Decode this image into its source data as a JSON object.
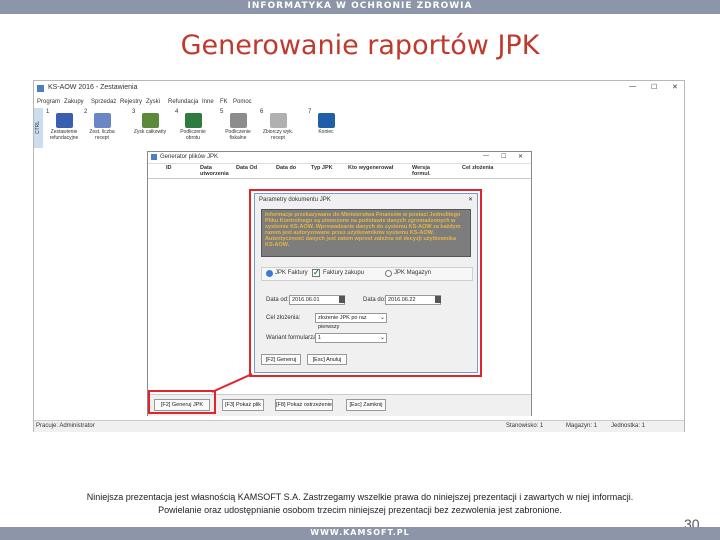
{
  "slide": {
    "header": "INFORMATYKA W OCHRONIE ZDROWIA",
    "title": "Generowanie raportów JPK",
    "disclaimer_line1": "Niniejsza prezentacja jest własnością KAMSOFT S.A. Zastrzegamy wszelkie prawa do niniejszej prezentacji i zawartych w niej informacji.",
    "disclaimer_line2": "Powielanie oraz udostępnianie osobom trzecim niniejszej prezentacji bez zezwolenia jest zabronione.",
    "page_number": "30",
    "footer": "WWW.KAMSOFT.PL"
  },
  "app": {
    "title": "KS-AOW 2016 - Zestawienia",
    "window_controls": [
      "—",
      "☐",
      "✕"
    ],
    "menu": [
      "Program",
      "Zakupy",
      "Sprzedaż",
      "Rejestry",
      "Zyski",
      "Refundacja",
      "Inne",
      "FK",
      "Pomoc"
    ],
    "sidebar_label": "CTRL",
    "toolbar": [
      {
        "num": "1",
        "label": "Zestawienie refundacyjne",
        "color": "#3a5fb0"
      },
      {
        "num": "2",
        "label": "Zest. liczba recept",
        "color": "#6b86c4"
      },
      {
        "num": "3",
        "label": "Zysk całkowity",
        "color": "#5a8a3a"
      },
      {
        "num": "4",
        "label": "Podliczenie obrotu",
        "color": "#2f7a3e"
      },
      {
        "num": "5",
        "label": "Podliczenie fiskalne",
        "color": "#8c8c8c"
      },
      {
        "num": "6",
        "label": "Zbiorczy wyk. recept",
        "color": "#b0b0b0"
      },
      {
        "num": "7",
        "label": "Koniec",
        "color": "#1f5fa8"
      }
    ],
    "status": {
      "operator": "Pracuje: Administrator",
      "stanowisko": "Stanowisko: 1",
      "magazyn": "Magazyn: 1",
      "jednostka": "Jednostka: 1"
    }
  },
  "generator": {
    "title": "Generator plików JPK",
    "columns": [
      "ID",
      "Data utworzenia",
      "Data Od",
      "Data do",
      "Typ JPK",
      "Kto wygenerował",
      "Wersja formul.",
      "Cel złożenia"
    ],
    "buttons": [
      "[F2] Generuj JPK",
      "[F3] Pokaż plik",
      "[F8] Pokaż ostrzeżenie",
      "[Esc] Zamknij"
    ]
  },
  "params": {
    "title": "Parametry dokumentu JPK",
    "info": "Informacje przekazywane do Ministerstwa Finansów w postaci Jednolitego Pliku Kontrolnego są utworzone na podstawie danych zgromadzonych w systemie KS-AOW. Wprowadzanie danych do systemu KS-AOW za każdym razem jest autoryzowane przez użytkowników systemu KS-AOW. Autentyczność danych jest zatem wprost zależna od decyzji użytkownika KS-AOW.",
    "options": [
      "JPK Faktury",
      "Faktury zakupu",
      "JPK Magazyn"
    ],
    "od_label": "Data od:",
    "od_value": "2016.06.01",
    "do_label": "Data do:",
    "do_value": "2016.06.22",
    "cel_label": "Cel złożenia:",
    "cel_value": "złożenie JPK po raz pierwszy",
    "wariant_label": "Wariant formularza:",
    "wariant_value": "1",
    "generate_button": "[F2] Generuj",
    "cancel_button": "[Esc] Anuluj"
  },
  "colors": {
    "title": "#c0392b",
    "highlight": "#e0242a",
    "info_bg": "#7d7d7d",
    "info_text": "#e8b640"
  }
}
